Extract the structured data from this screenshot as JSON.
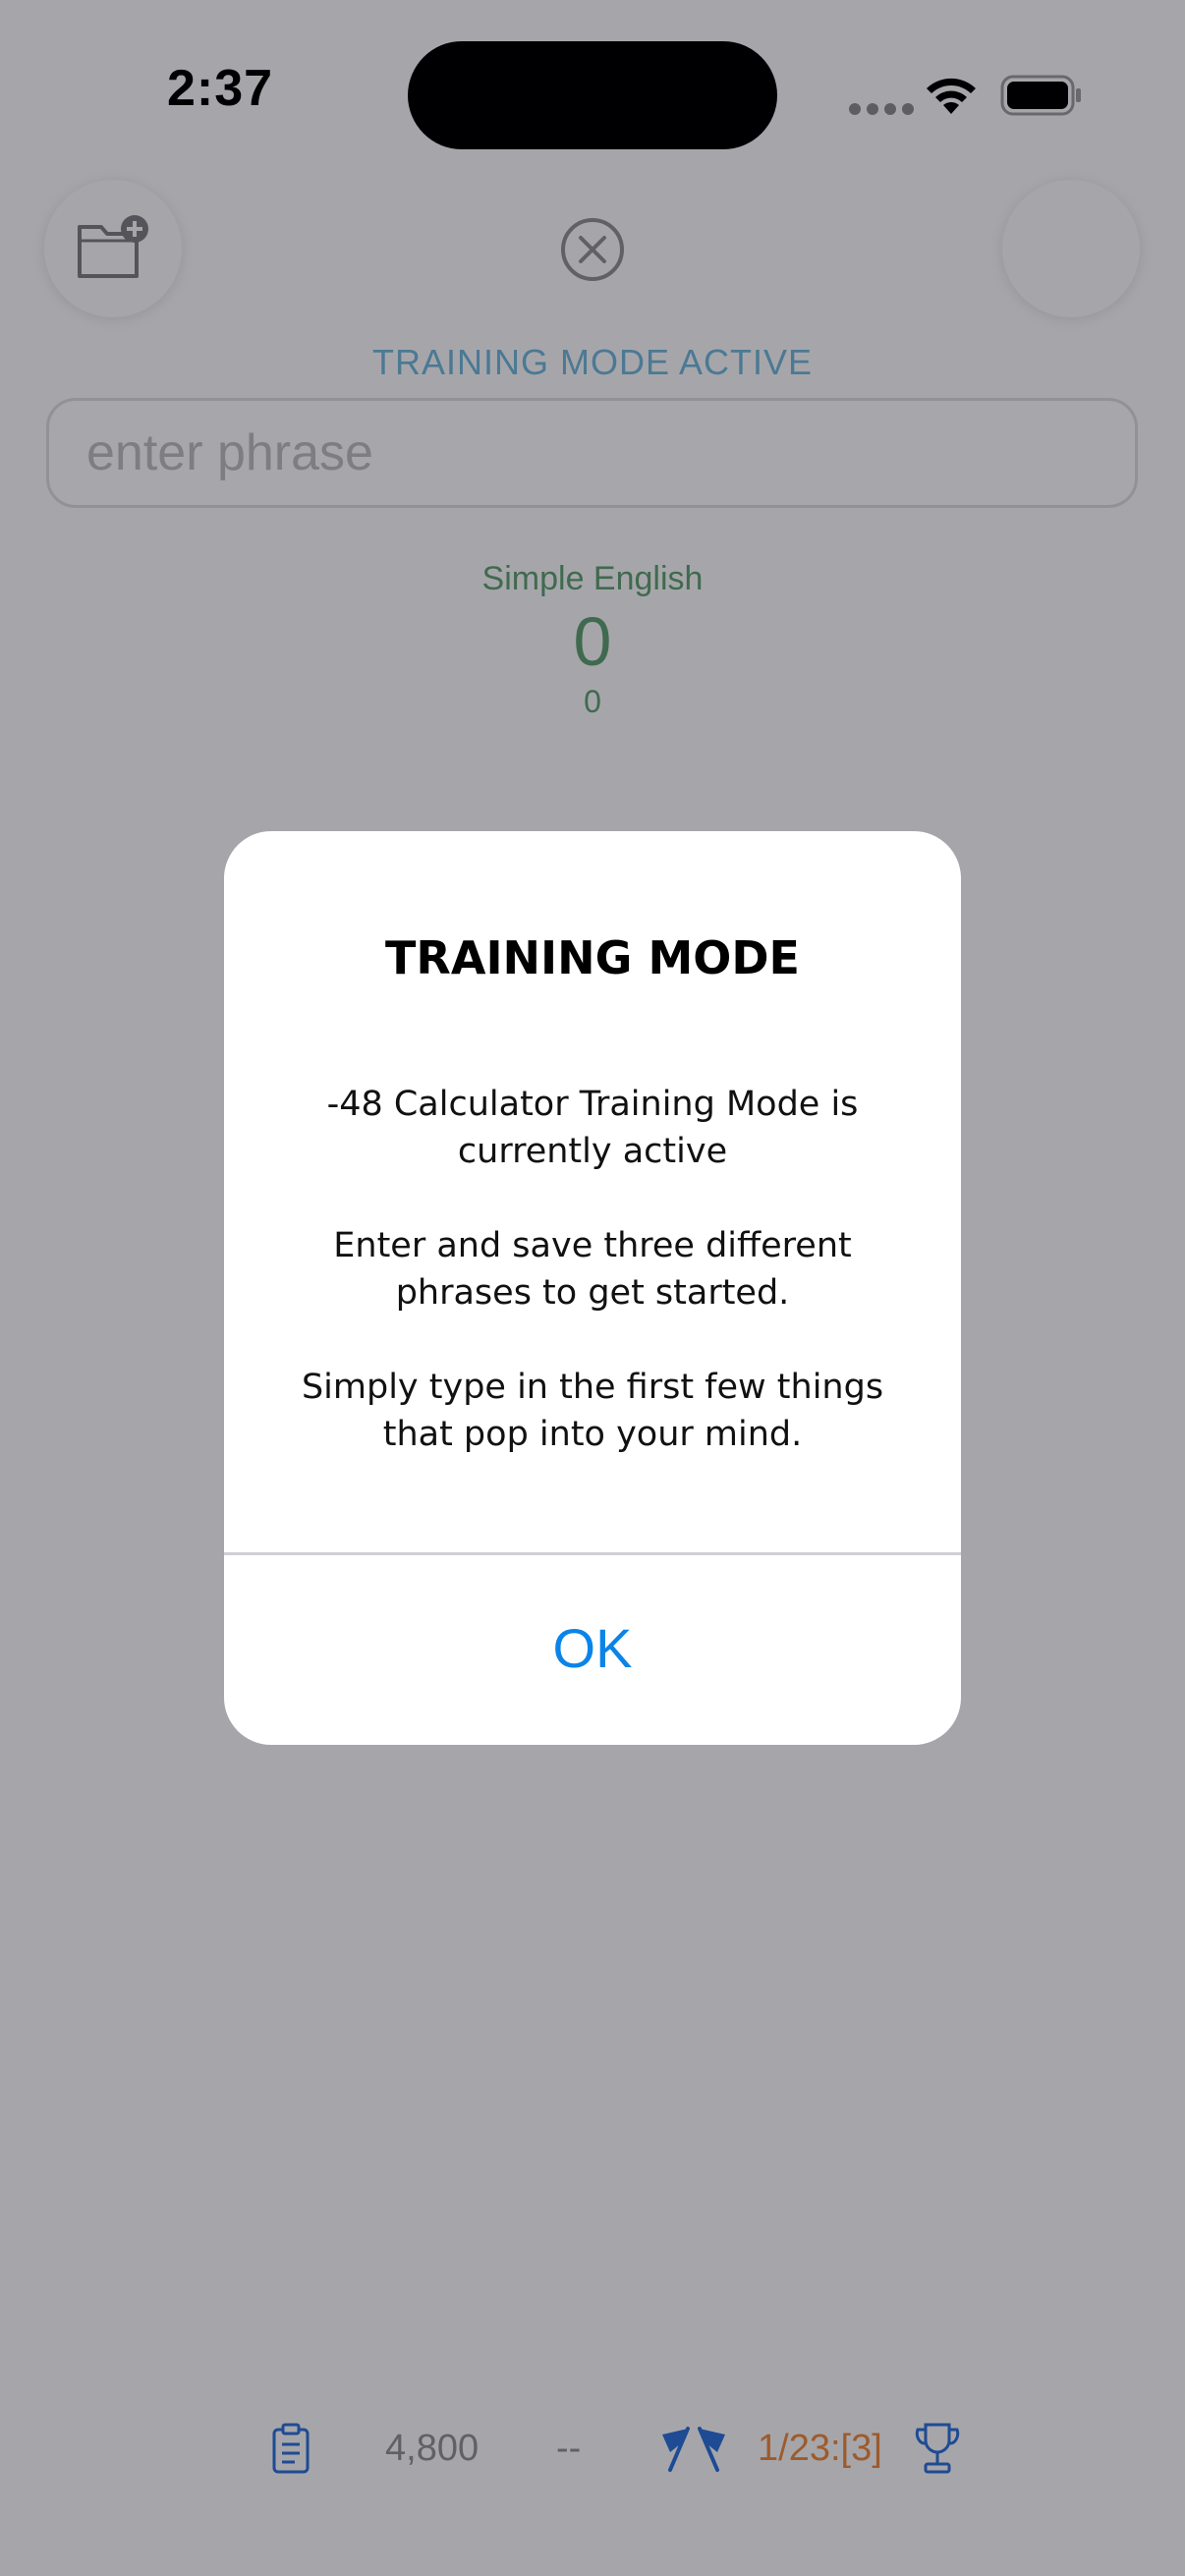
{
  "status_bar": {
    "time": "2:37"
  },
  "app": {
    "mode_label": "TRAINING MODE ACTIVE",
    "phrase_placeholder": "enter phrase",
    "language": {
      "name": "Simple English",
      "value": "0",
      "sub_value": "0"
    }
  },
  "bottom_bar": {
    "count": "4,800",
    "dash": "--",
    "score": "1/23:[3]"
  },
  "dialog": {
    "title": "TRAINING MODE",
    "paragraphs": [
      "-48 Calculator Training Mode is currently active",
      "Enter and save three different phrases to get started.",
      "Simply type in the first few things that pop into your mind."
    ],
    "ok_label": "OK"
  },
  "colors": {
    "accent_blue": "#0a84e8",
    "mode_label": "#6fb3d6",
    "language_green": "#5f9c70",
    "score_orange": "#e7873f"
  },
  "icons": [
    "folder-add-icon",
    "close-circle-icon",
    "clipboard-icon",
    "checkered-flags-icon",
    "trophy-icon",
    "wifi-icon",
    "battery-icon"
  ]
}
